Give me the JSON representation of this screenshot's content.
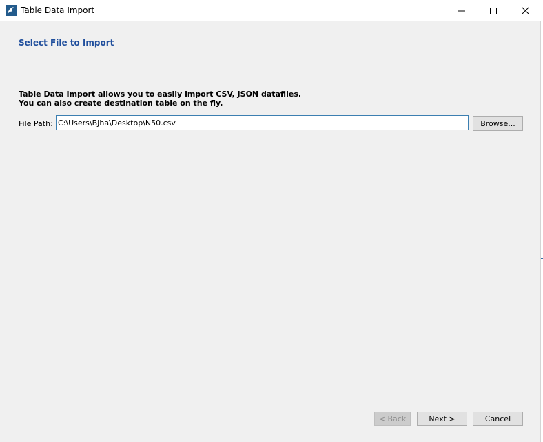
{
  "window": {
    "title": "Table Data Import",
    "icons": [
      "mysql-dolphin-icon",
      "minimize-icon",
      "maximize-icon",
      "close-icon"
    ]
  },
  "page": {
    "heading": "Select File to Import",
    "description_line1": "Table Data Import allows you to easily import CSV, JSON datafiles.",
    "description_line2": "You can also create destination table on the fly."
  },
  "file_path": {
    "label": "File Path:",
    "value": "C:\\Users\\BJha\\Desktop\\N50.csv",
    "browse_label": "Browse..."
  },
  "footer": {
    "back_label": "< Back",
    "next_label": "Next >",
    "cancel_label": "Cancel"
  },
  "colors": {
    "heading": "#1f4e9c",
    "background": "#f0f0f0",
    "input_border": "#3c7fb1"
  }
}
